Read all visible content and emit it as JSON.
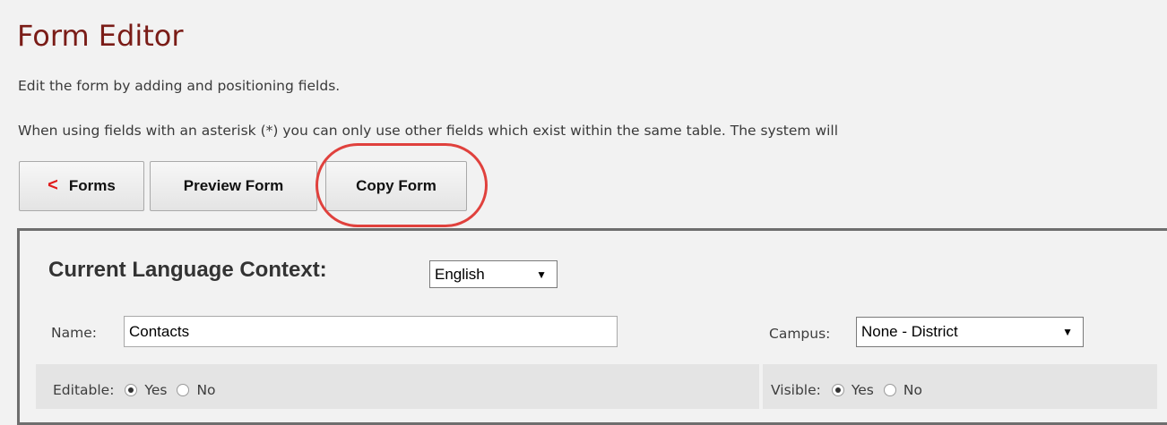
{
  "page": {
    "title": "Form Editor",
    "description": "Edit the form by adding and positioning fields.",
    "note": "When using fields with an asterisk (*) you can only use other fields which exist within the same table. The system will"
  },
  "toolbar": {
    "forms_chevron": "<",
    "forms_label": "Forms",
    "preview_label": "Preview Form",
    "copy_label": "Copy Form"
  },
  "form": {
    "language_context_label": "Current Language Context:",
    "language_selected": "English",
    "name_label": "Name:",
    "name_value": "Contacts",
    "campus_label": "Campus:",
    "campus_selected": "None - District",
    "editable_label": "Editable:",
    "editable_yes": "Yes",
    "editable_no": "No",
    "editable_value": "Yes",
    "visible_label": "Visible:",
    "visible_yes": "Yes",
    "visible_no": "No",
    "visible_value": "Yes"
  },
  "icons": {
    "select_arrow": "▼"
  },
  "colors": {
    "title": "#7a1c17",
    "forms_chevron": "#e01a1a",
    "highlight_ring": "#e0413d",
    "background": "#f2f2f2"
  }
}
